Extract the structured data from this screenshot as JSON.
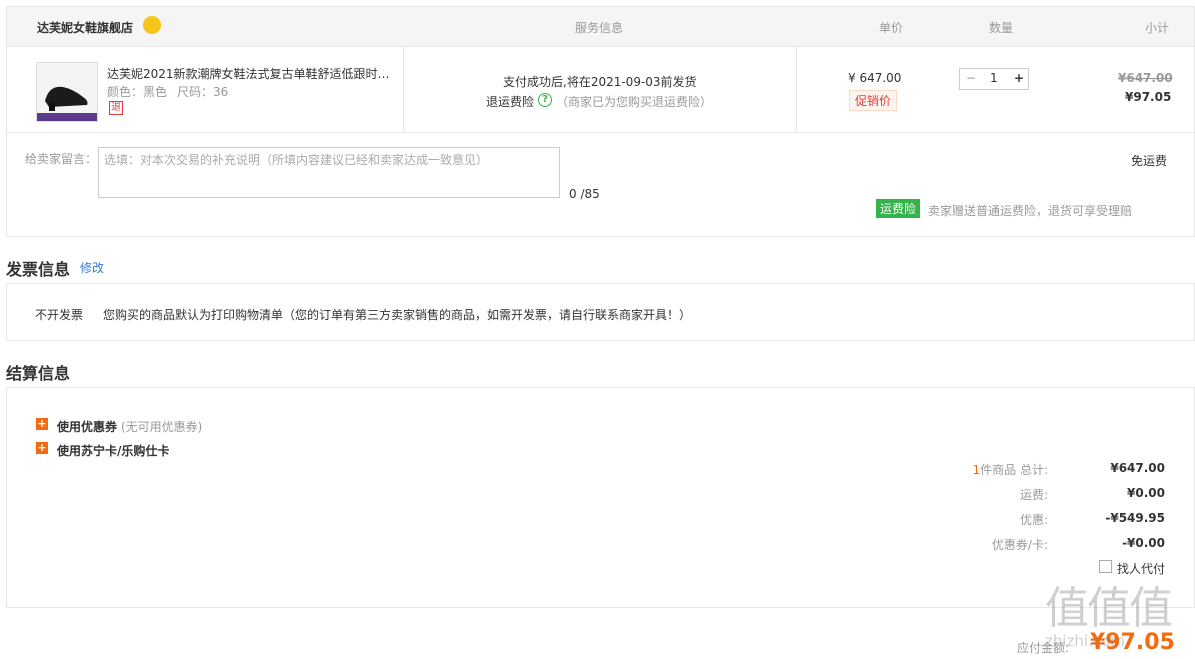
{
  "header": {
    "store_name": "达芙妮女鞋旗舰店",
    "col_service": "服务信息",
    "col_price": "单价",
    "col_qty": "数量",
    "col_subtotal": "小计"
  },
  "item": {
    "title": "达芙妮2021新款潮牌女鞋法式复古单鞋舒适低跟时…",
    "color_label": "颜色：黑色",
    "size_label": "尺码：36",
    "return_badge": "退",
    "ship_note": "支付成功后,将在2021-09-03前发货",
    "insurance_label": "退运费险",
    "insurance_note": "（商家已为您购买退运费险）",
    "unit_price": "¥ 647.00",
    "promo_tag": "促销价",
    "quantity": "1",
    "minus": "−",
    "plus": "+",
    "original_price": "¥647.00",
    "final_price": "¥97.05"
  },
  "message": {
    "label": "给卖家留言：",
    "placeholder": "选填：对本次交易的补充说明（所填内容建议已经和卖家达成一致意见）",
    "counter": "0 /85",
    "shipping": "免运费",
    "insurance_tag": "运费险",
    "insurance_desc": "卖家赠送普通运费险，退货可享受理赔"
  },
  "invoice": {
    "title": "发票信息",
    "edit": "修改",
    "type": "不开发票",
    "desc": "您购买的商品默认为打印购物清单（您的订单有第三方卖家销售的商品，如需开发票，请自行联系商家开具！）"
  },
  "settlement": {
    "title": "结算信息",
    "coupon_label": "使用优惠券",
    "coupon_note": "(无可用优惠券)",
    "card_label": "使用苏宁卡/乐购仕卡",
    "count_prefix": "1",
    "total_label": "件商品 总计:",
    "total_value": "¥647.00",
    "shipping_label": "运费:",
    "shipping_value": "¥0.00",
    "discount_label": "优惠:",
    "discount_value": "-¥549.95",
    "coupon_card_label": "优惠券/卡:",
    "coupon_card_value": "-¥0.00",
    "proxy_pay": "找人代付",
    "payable_label": "应付金额:",
    "payable_value": "¥97.05"
  },
  "watermark": {
    "text": "值值值",
    "sub": "zhizhi.com"
  },
  "colors": {
    "accent": "#f36b10",
    "red": "#e4393c",
    "green": "#33b34a",
    "link": "#3a7bd5"
  }
}
